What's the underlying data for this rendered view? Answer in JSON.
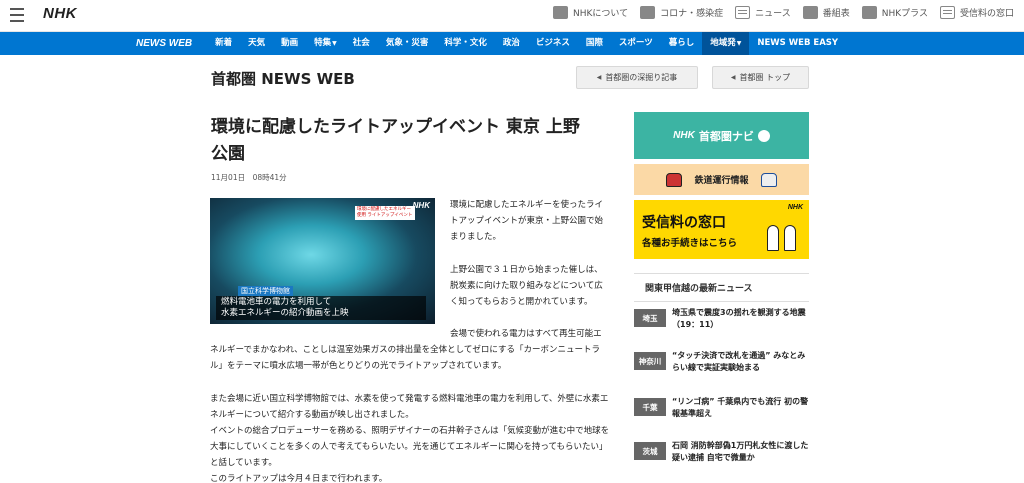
{
  "top": {
    "logo": "NHK",
    "links": [
      {
        "label": "NHKについて",
        "icon": "nhk-logo-icon"
      },
      {
        "label": "コロナ・感染症",
        "icon": "virus-icon"
      },
      {
        "label": "ニュース",
        "icon": "news-icon"
      },
      {
        "label": "番組表",
        "icon": "program-guide-icon"
      },
      {
        "label": "NHKプラス",
        "icon": "nhk-plus-icon"
      },
      {
        "label": "受信料の窓口",
        "icon": "receipt-icon"
      }
    ]
  },
  "nav": {
    "brand": "NEWS WEB",
    "items": [
      "新着",
      "天気",
      "動画",
      "特集",
      "社会",
      "気象・災害",
      "科学・文化",
      "政治",
      "ビジネス",
      "国際",
      "スポーツ",
      "暮らし",
      "地域発",
      "NEWS WEB EASY"
    ],
    "active": "地域発"
  },
  "section": {
    "title": "首都圏 NEWS WEB",
    "btn_deep": "首都圏の深掘り記事",
    "btn_top": "首都圏 トップ"
  },
  "article": {
    "title_line1": "環境に配慮したライトアップイベント 東京 上野",
    "title_line2": "公園",
    "date": "11月01日　08時41分",
    "image": {
      "logo": "NHK",
      "tag": "環境に配慮したエネルギー使用 ライトアップイベント",
      "caption_small": "国立科学博物館",
      "caption_line1": "燃料電池車の電力を利用して",
      "caption_line2": "水素エネルギーの紹介動画を上映"
    },
    "p1": "環境に配慮したエネルギーを使ったライトアップイベントが東京・上野公園で始まりました。",
    "p2": "上野公園で３１日から始まった催しは、脱炭素に向けた取り組みなどについて広く知ってもらおうと開かれています。",
    "p3": "会場で使われる電力はすべて再生可能エネルギーでまかなわれ、ことしは温室効果ガスの排出量を全体としてゼロにする「カーボンニュートラル」をテーマに噴水広場一帯が色とりどりの光でライトアップされています。",
    "p4": "また会場に近い国立科学博物館では、水素を使って発電する燃料電池車の電力を利用して、外壁に水素エネルギーについて紹介する動画が映し出されました。",
    "p5": "イベントの総合プロデューサーを務める、照明デザイナーの石井幹子さんは「気候変動が進む中で地球を大事にしていくことを多くの人で考えてもらいたい。光を通じてエネルギーに関心を持ってもらいたい」と話しています。",
    "p6": "このライトアップは今月４日まで行われます。"
  },
  "sidebar": {
    "banner1": {
      "nhk": "NHK",
      "label": "首都圏ナビ"
    },
    "banner2": {
      "label": "鉄道運行情報"
    },
    "banner3": {
      "line1": "受信料の窓口",
      "line2": "各種お手続きはこちら",
      "nhk": "NHK"
    },
    "news_heading": "関東甲信越の最新ニュース",
    "news": [
      {
        "pref": "埼玉",
        "text": "埼玉県で震度3の揺れを観測する地震（19：11）"
      },
      {
        "pref": "神奈川",
        "text": "“タッチ決済で改札を通過” みなとみらい線で実証実験始まる"
      },
      {
        "pref": "千葉",
        "text": "“リンゴ病” 千葉県内でも流行 初の警報基準超え"
      },
      {
        "pref": "茨城",
        "text": "石岡 消防幹部偽1万円札女性に渡した疑い逮捕 自宅で微量か"
      }
    ]
  }
}
